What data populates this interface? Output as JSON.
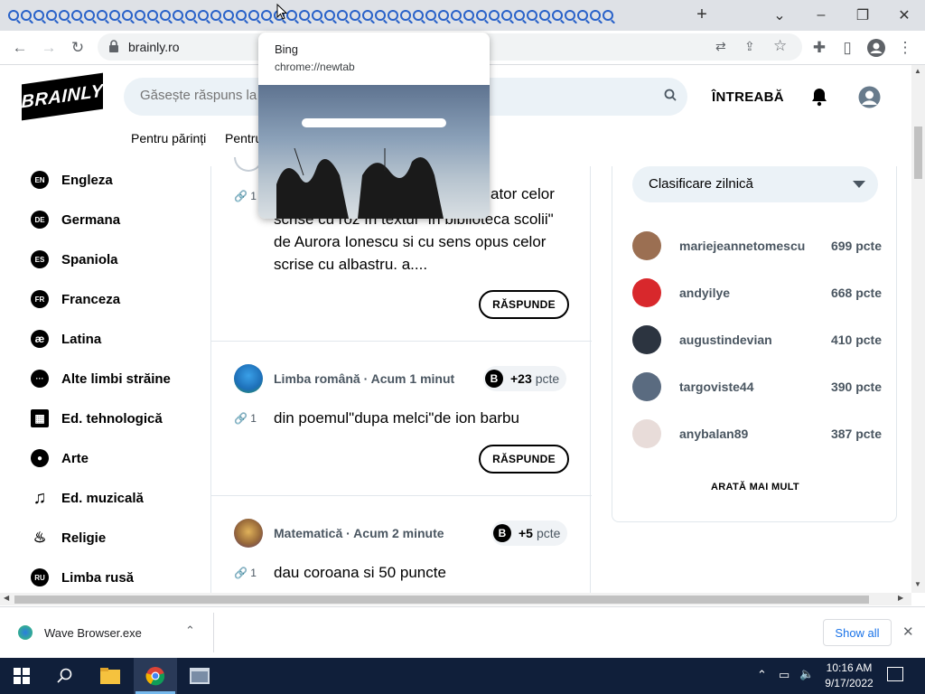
{
  "browser": {
    "tab_icon_count": 48,
    "new_tab_label": "+",
    "address": "brainly.ro",
    "window": {
      "minimize": "–",
      "restore": "❐",
      "close": "✕"
    }
  },
  "preview": {
    "title": "Bing",
    "url": "chrome://newtab"
  },
  "header": {
    "logo": "BRAINLY",
    "search_placeholder": "Găsește răspuns la orice întrebare",
    "ask": "ÎNTREABĂ",
    "subnav": [
      "Pentru părinți",
      "Pentru"
    ]
  },
  "subjects": [
    {
      "badge": "EN",
      "label": "Engleza"
    },
    {
      "badge": "DE",
      "label": "Germana"
    },
    {
      "badge": "ES",
      "label": "Spaniola"
    },
    {
      "badge": "FR",
      "label": "Franceza"
    },
    {
      "badge": "æ",
      "label": "Latina"
    },
    {
      "badge": "···",
      "label": "Alte limbi străine"
    },
    {
      "badge": "▦",
      "label": "Ed. tehnologică"
    },
    {
      "badge": "●",
      "label": "Arte"
    },
    {
      "badge": "♫",
      "label": "Ed. muzicală"
    },
    {
      "badge": "♨",
      "label": "Religie"
    },
    {
      "badge": "RU",
      "label": "Limba rusă"
    }
  ],
  "feed": {
    "q1": {
      "attach": "1",
      "text_line1": "ator celor",
      "text_rest": "scrise cu roz în textul \"În biblioteca scolii\" de Aurora Ionescu si cu sens opus celor scrise cu albastru. a....",
      "button": "RĂSPUNDE"
    },
    "q2": {
      "meta": "Limba română · Acum 1 minut",
      "points": "+23",
      "unit": "pcte",
      "attach": "1",
      "text": "din poemul\"dupa melci\"de ion barbu",
      "button": "RĂSPUNDE"
    },
    "q3": {
      "meta": "Matematică · Acum 2 minute",
      "points": "+5",
      "unit": "pcte",
      "attach": "1",
      "text": "dau coroana si 50 puncte"
    }
  },
  "ranking": {
    "select": "Clasificare zilnică",
    "users": [
      {
        "name": "mariejeannetomescu",
        "points": "699 pcte",
        "color": "#9b6f52"
      },
      {
        "name": "andyilye",
        "points": "668 pcte",
        "color": "#d8282c"
      },
      {
        "name": "augustindevian",
        "points": "410 pcte",
        "color": "#2c3440"
      },
      {
        "name": "targoviste44",
        "points": "390 pcte",
        "color": "#5a6b80"
      },
      {
        "name": "anybalan89",
        "points": "387 pcte",
        "color": "#e8dcd9"
      }
    ],
    "show_more": "ARATĂ MAI MULT"
  },
  "download": {
    "file": "Wave Browser.exe",
    "show_all": "Show all"
  },
  "taskbar": {
    "time": "10:16 AM",
    "date": "9/17/2022"
  }
}
